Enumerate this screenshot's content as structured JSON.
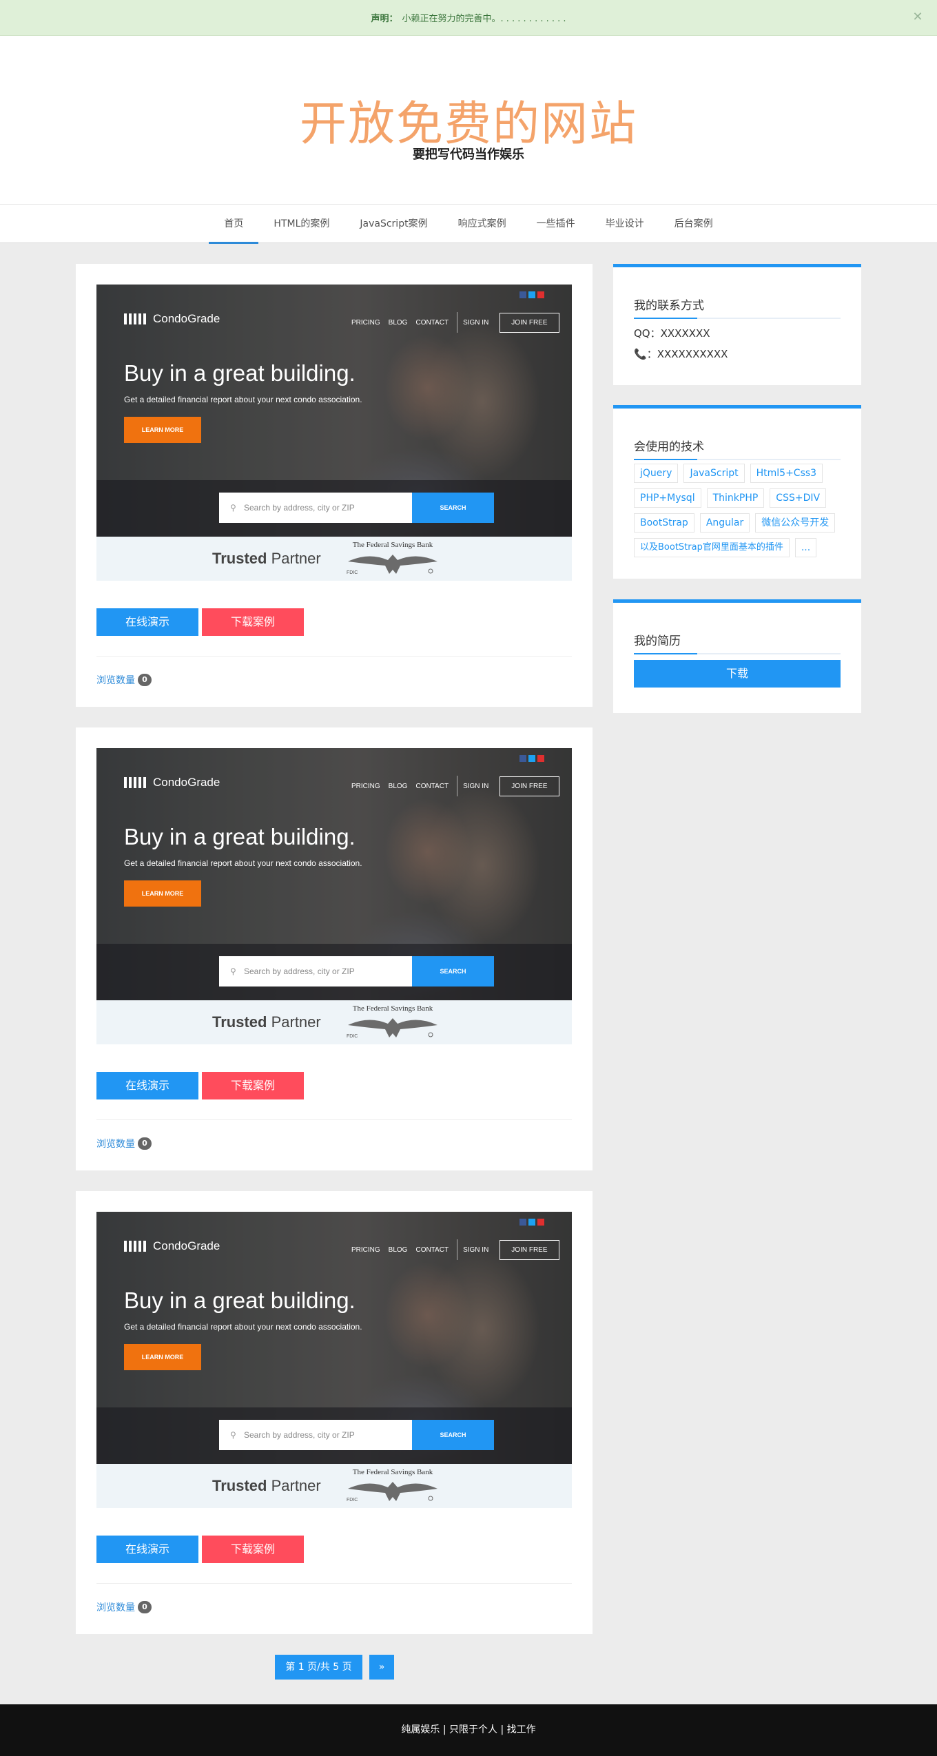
{
  "notice": {
    "label": "声明：",
    "text": "小赖正在努力的完善中。. . . . . . . . . . . .",
    "close": "✕"
  },
  "header": {
    "title": "开放免费的网站",
    "subtitle": "要把写代码当作娱乐"
  },
  "nav": [
    "首页",
    "HTML的案例",
    "JavaScript案例",
    "响应式案例",
    "一些插件",
    "毕业设计",
    "后台案例"
  ],
  "post_preview": {
    "brand": "CondoGrade",
    "nav": [
      "PRICING",
      "BLOG",
      "CONTACT",
      "SIGN IN"
    ],
    "join": "JOIN FREE",
    "headline": "Buy in a great building.",
    "subline": "Get a detailed financial report about your next condo association.",
    "learn_more": "LEARN MORE",
    "search_placeholder": "Search by address, city or ZIP",
    "search_button": "SEARCH",
    "trusted_bold": "Trusted",
    "trusted_rest": " Partner",
    "bank_name": "The Federal Savings Bank",
    "fdic": "FDIC"
  },
  "posts": [
    {
      "demo_label": "在线演示",
      "download_label": "下载案例",
      "views_label": "浏览数量",
      "views_count": "0"
    },
    {
      "demo_label": "在线演示",
      "download_label": "下载案例",
      "views_label": "浏览数量",
      "views_count": "0"
    },
    {
      "demo_label": "在线演示",
      "download_label": "下载案例",
      "views_label": "浏览数量",
      "views_count": "0"
    }
  ],
  "sidebar": {
    "contact": {
      "title": "我的联系方式",
      "qq": "QQ：XXXXXXX",
      "phone": "：XXXXXXXXXX"
    },
    "skills": {
      "title": "会使用的技术",
      "tags": [
        "jQuery",
        "JavaScript",
        "Html5+Css3",
        "PHP+Mysql",
        "ThinkPHP",
        "CSS+DIV",
        "BootStrap",
        "Angular",
        "微信公众号开发",
        "以及BootStrap官网里面基本的插件",
        "..."
      ]
    },
    "resume": {
      "title": "我的简历",
      "button": "下载"
    }
  },
  "pager": {
    "current": "第 1 页/共 5 页",
    "next": "»"
  },
  "footer": {
    "text": "纯属娱乐 | 只限于个人 | 找工作"
  },
  "colors": {
    "accent": "#2196f3",
    "danger": "#ff4c5c",
    "title": "#f4a36a"
  }
}
